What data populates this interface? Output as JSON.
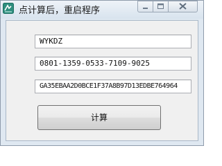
{
  "window": {
    "title": "点计算后，重启程序"
  },
  "fields": {
    "name_value": "WYKDZ",
    "serial_value": "0801-1359-0533-7109-9025",
    "code_value": "GA35EBAA2D0BCE1F37A8B97D13EDBE764964"
  },
  "button": {
    "calc_label": "计算"
  },
  "icons": {
    "app": "app-icon",
    "minimize": "minimize-icon",
    "maximize": "maximize-icon",
    "close": "close-icon"
  },
  "colors": {
    "window_frame": "#dfe8f1",
    "client_bg": "#f0f0f0"
  }
}
